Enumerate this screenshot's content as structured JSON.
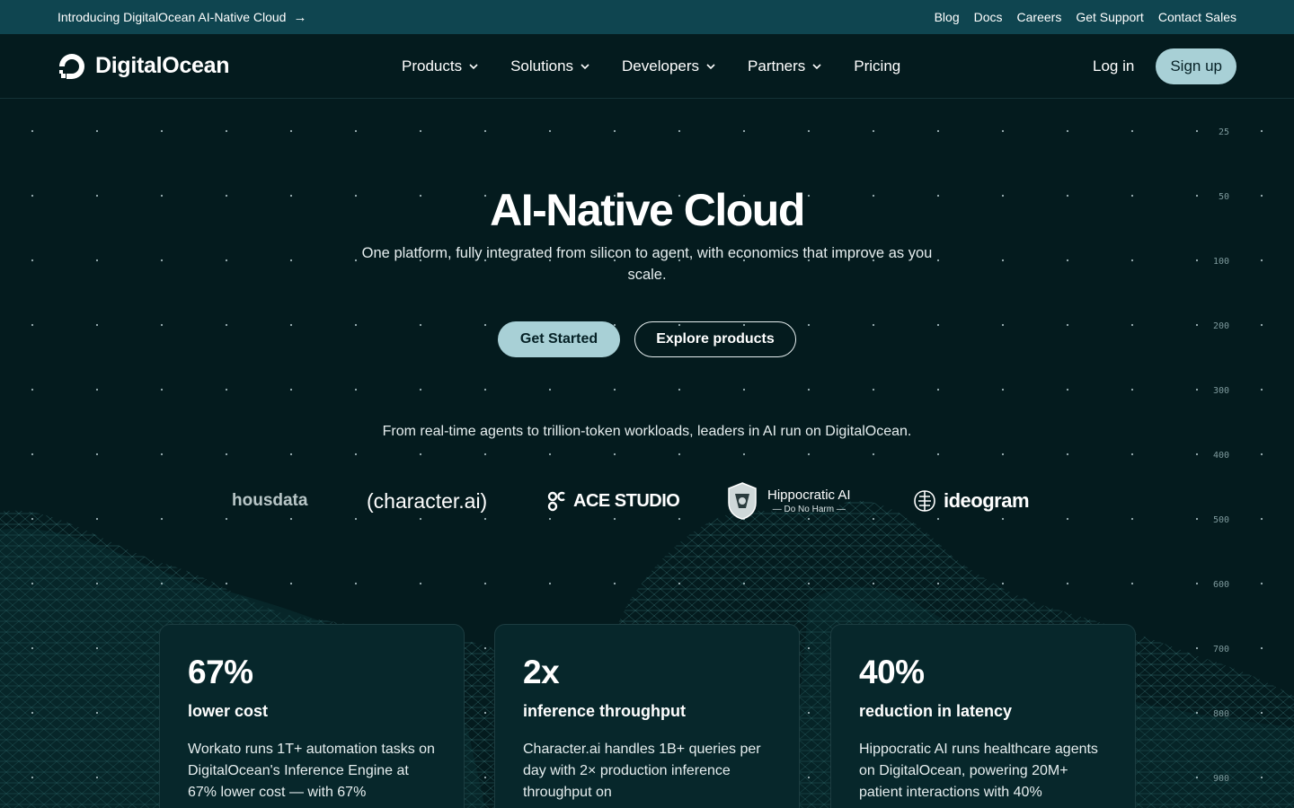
{
  "topbar": {
    "announcement": "Introducing DigitalOcean AI-Native Cloud",
    "links": [
      "Blog",
      "Docs",
      "Careers",
      "Get Support",
      "Contact Sales"
    ]
  },
  "nav": {
    "brand": "DigitalOcean",
    "menu": [
      "Products",
      "Solutions",
      "Developers",
      "Partners",
      "Pricing"
    ],
    "login": "Log in",
    "signup": "Sign up"
  },
  "hero": {
    "title": "AI-Native Cloud",
    "subtitle": "One platform, fully integrated from silicon to agent, with economics that improve as you scale.",
    "primary_cta": "Get Started",
    "secondary_cta": "Explore products",
    "leaders_text": "From real-time agents to trillion-token workloads, leaders in AI run on DigitalOcean."
  },
  "ruler_labels": [
    "25",
    "50",
    "100",
    "200",
    "300",
    "400",
    "500",
    "600",
    "700",
    "800",
    "900"
  ],
  "customer_logos": {
    "housdata": "housdata",
    "character": "(character.ai)",
    "ace": "ACE STUDIO",
    "hippocratic_name": "Hippocratic AI",
    "hippocratic_tagline": "Do No Harm",
    "ideogram": "ideogram"
  },
  "stats": [
    {
      "value": "67%",
      "label": "lower cost",
      "desc": "Workato runs 1T+ automation tasks on DigitalOcean's Inference Engine at 67% lower cost — with 67%"
    },
    {
      "value": "2x",
      "label": "inference throughput",
      "desc": "Character.ai handles 1B+ queries per day with 2× production inference throughput on"
    },
    {
      "value": "40%",
      "label": "reduction in latency",
      "desc": "Hippocratic AI runs healthcare agents on DigitalOcean, powering 20M+ patient interactions with 40%"
    }
  ],
  "colors": {
    "background": "#041b1e",
    "topbar": "#0f4550",
    "accent": "#a8d0d6",
    "card": "#07272b"
  }
}
